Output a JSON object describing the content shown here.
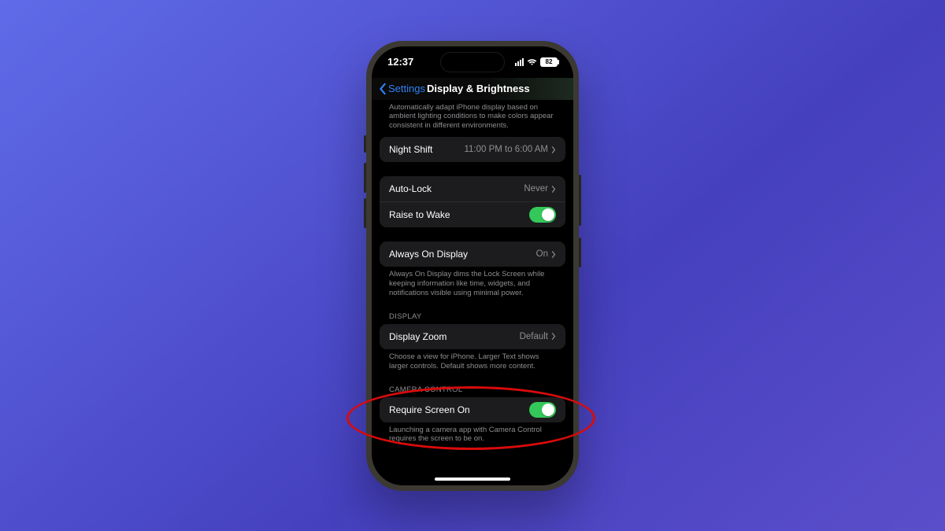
{
  "status": {
    "time": "12:37",
    "battery": "82"
  },
  "nav": {
    "back_label": "Settings",
    "title": "Display & Brightness"
  },
  "true_tone": {
    "footnote": "Automatically adapt iPhone display based on ambient lighting conditions to make colors appear consistent in different environments."
  },
  "night_shift": {
    "label": "Night Shift",
    "value": "11:00 PM to 6:00 AM"
  },
  "auto_lock": {
    "label": "Auto-Lock",
    "value": "Never"
  },
  "raise_to_wake": {
    "label": "Raise to Wake"
  },
  "always_on": {
    "label": "Always On Display",
    "value": "On",
    "footnote": "Always On Display dims the Lock Screen while keeping information like time, widgets, and notifications visible using minimal power."
  },
  "display_section": {
    "header": "Display"
  },
  "display_zoom": {
    "label": "Display Zoom",
    "value": "Default",
    "footnote": "Choose a view for iPhone. Larger Text shows larger controls. Default shows more content."
  },
  "camera_section": {
    "header": "Camera Control"
  },
  "require_screen_on": {
    "label": "Require Screen On",
    "footnote": "Launching a camera app with Camera Control requires the screen to be on."
  }
}
